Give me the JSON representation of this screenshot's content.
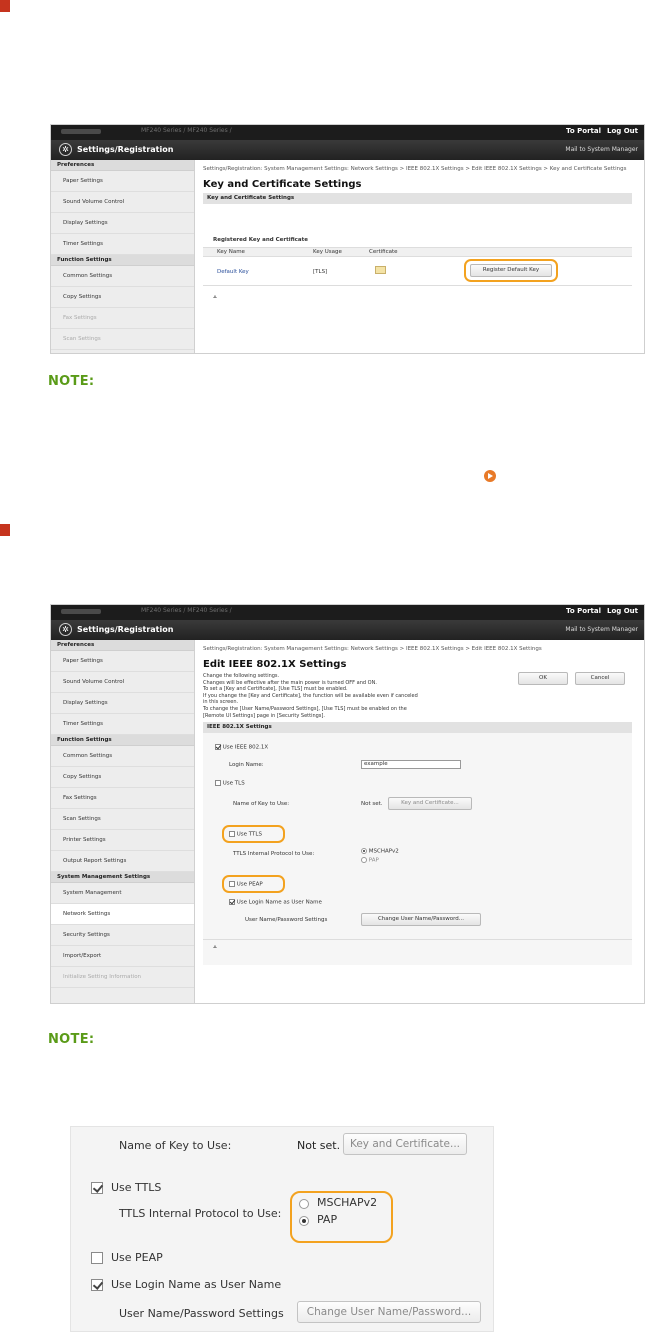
{
  "notes": {
    "note1": "NOTE:",
    "note2": "NOTE:"
  },
  "accent_color": "#f3a21f",
  "step_marker_color": "#c6341e",
  "note_color": "#5a9b18",
  "shot1": {
    "topbar": {
      "model": "MF240 Series / MF240 Series /",
      "portal": "To Portal",
      "logout": "Log Out"
    },
    "appbar": {
      "title": "Settings/Registration",
      "mail": "Mail to System Manager"
    },
    "sidebar": {
      "preferences": "Preferences",
      "pref_items": [
        "Paper Settings",
        "Sound Volume Control",
        "Display Settings",
        "Timer Settings"
      ],
      "function": "Function Settings",
      "func_items": [
        "Common Settings",
        "Copy Settings",
        "Fax Settings",
        "Scan Settings"
      ]
    },
    "breadcrumb": "Settings/Registration: System Management Settings: Network Settings > IEEE 802.1X Settings > Edit IEEE 802.1X Settings > Key and Certificate Settings",
    "heading": "Key and Certificate Settings",
    "section": "Key and Certificate Settings",
    "subsection": "Registered Key and Certificate",
    "table": {
      "headers": [
        "Key Name",
        "Key Usage",
        "Certificate"
      ],
      "row": {
        "key_name": "Default Key",
        "key_usage": "[TLS]"
      }
    },
    "register_button": "Register Default Key",
    "top_link": "⩡"
  },
  "shot2": {
    "topbar": {
      "model": "MF240 Series / MF240 Series /",
      "portal": "To Portal",
      "logout": "Log Out"
    },
    "appbar": {
      "title": "Settings/Registration",
      "mail": "Mail to System Manager"
    },
    "sidebar": {
      "preferences": "Preferences",
      "pref_items": [
        "Paper Settings",
        "Sound Volume Control",
        "Display Settings",
        "Timer Settings"
      ],
      "function": "Function Settings",
      "func_items": [
        "Common Settings",
        "Copy Settings",
        "Fax Settings",
        "Scan Settings",
        "Printer Settings",
        "Output Report Settings"
      ],
      "system": "System Management Settings",
      "sys_items": [
        "System Management",
        "Network Settings",
        "Security Settings",
        "Import/Export",
        "Initialize Setting Information"
      ]
    },
    "breadcrumb": "Settings/Registration: System Management Settings: Network Settings > IEEE 802.1X Settings > Edit IEEE 802.1X Settings",
    "heading": "Edit IEEE 802.1X Settings",
    "ok": "OK",
    "cancel": "Cancel",
    "info": [
      "Change the following settings.",
      "Changes will be effective after the main power is turned OFF and ON.",
      "To set a [Key and Certificate], [Use TLS] must be enabled.",
      "If you change the [Key and Certificate], the function will be available even if canceled",
      "in this screen.",
      "To change the [User Name/Password Settings], [Use TLS] must be enabled on the",
      "[Remote UI Settings] page in [Security Settings]."
    ],
    "section": "IEEE 802.1X Settings",
    "use_ieee": "Use IEEE 802.1X",
    "login_name_label": "Login Name:",
    "login_name_value": "example",
    "use_tls": "Use TLS",
    "key_label": "Name of Key to Use:",
    "not_set": "Not set.",
    "key_button": "Key and Certificate...",
    "use_ttls": "Use TTLS",
    "ttls_label": "TTLS Internal Protocol to Use:",
    "mschap": "MSCHAPv2",
    "pap": "PAP",
    "use_peap": "Use PEAP",
    "use_login": "Use Login Name as User Name",
    "user_pw_label": "User Name/Password Settings",
    "user_pw_button": "Change User Name/Password...",
    "top_link": "⩡"
  },
  "zoom": {
    "key_label": "Name of Key to Use:",
    "not_set": "Not set.",
    "key_button": "Key and Certificate...",
    "use_ttls": "Use TTLS",
    "ttls_label": "TTLS Internal Protocol to Use:",
    "mschap": "MSCHAPv2",
    "pap": "PAP",
    "use_peap": "Use PEAP",
    "use_login": "Use Login Name as User Name",
    "user_pw_label": "User Name/Password Settings",
    "user_pw_button": "Change User Name/Password...",
    "ttls_checked": true,
    "pap_selected": true,
    "peap_checked": false,
    "login_checked": true
  }
}
